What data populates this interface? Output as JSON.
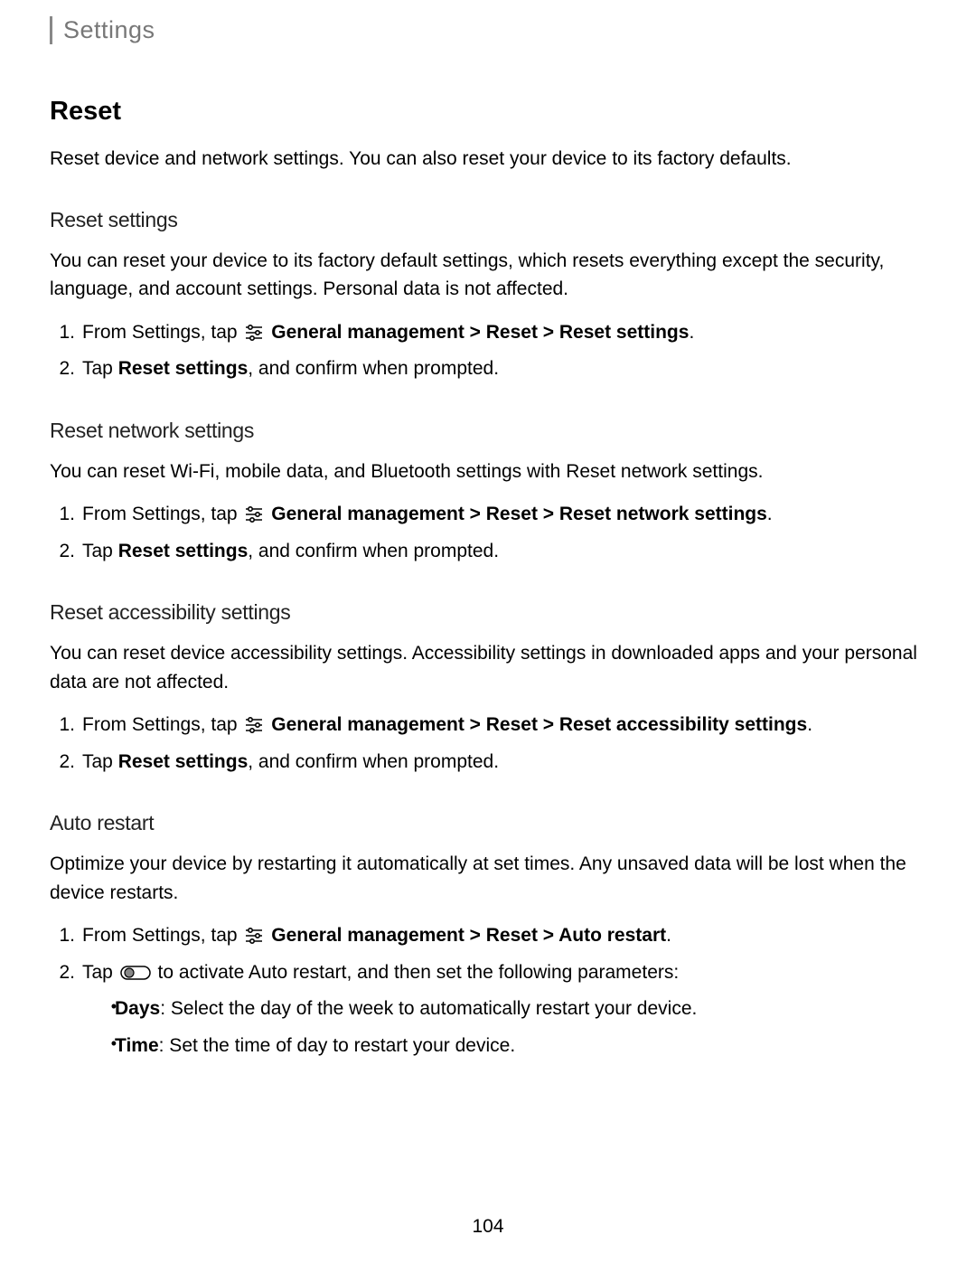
{
  "header": "Settings",
  "title": "Reset",
  "intro": "Reset device and network settings. You can also reset your device to its factory defaults.",
  "sections": {
    "reset_settings": {
      "heading": "Reset settings",
      "text": "You can reset your device to its factory default settings, which resets everything except the security, language, and account settings. Personal data is not affected.",
      "step1_prefix": "From Settings, tap ",
      "step1_path": "General management > Reset > Reset settings",
      "step1_suffix": ".",
      "step2_prefix": "Tap ",
      "step2_bold": "Reset settings",
      "step2_suffix": ", and confirm when prompted."
    },
    "reset_network": {
      "heading": "Reset network settings",
      "text": "You can reset Wi-Fi, mobile data, and Bluetooth settings with Reset network settings.",
      "step1_prefix": "From Settings, tap ",
      "step1_path": "General management > Reset > Reset network settings",
      "step1_suffix": ".",
      "step2_prefix": "Tap ",
      "step2_bold": "Reset settings",
      "step2_suffix": ", and confirm when prompted."
    },
    "reset_accessibility": {
      "heading": "Reset accessibility settings",
      "text": "You can reset device accessibility settings. Accessibility settings in downloaded apps and your personal data are not affected.",
      "step1_prefix": "From Settings, tap ",
      "step1_path": "General management > Reset > Reset accessibility settings",
      "step1_suffix": ".",
      "step2_prefix": "Tap ",
      "step2_bold": "Reset settings",
      "step2_suffix": ", and confirm when prompted."
    },
    "auto_restart": {
      "heading": "Auto restart",
      "text": "Optimize your device by restarting it automatically at set times. Any unsaved data will be lost when the device restarts.",
      "step1_prefix": "From Settings, tap ",
      "step1_path": "General management > Reset > Auto restart",
      "step1_suffix": ".",
      "step2_prefix": "Tap ",
      "step2_suffix": " to activate Auto restart, and then set the following parameters:",
      "bullet1_bold": "Days",
      "bullet1_text": ": Select the day of the week to automatically restart your device.",
      "bullet2_bold": "Time",
      "bullet2_text": ": Set the time of day to restart your device."
    }
  },
  "page_number": "104"
}
